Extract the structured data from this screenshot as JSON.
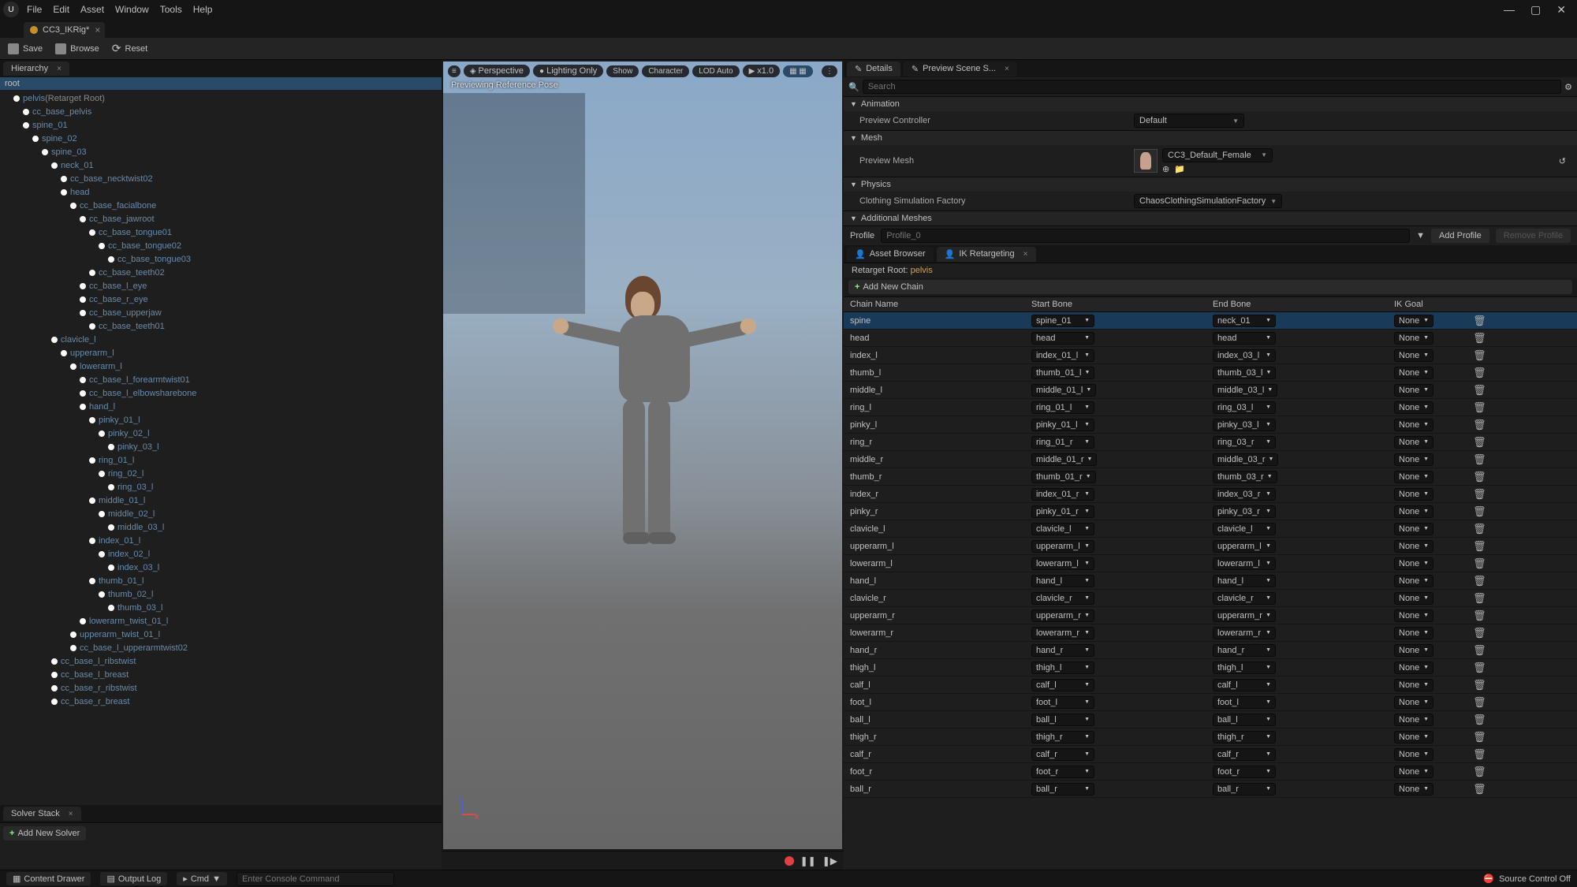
{
  "menu": {
    "file": "File",
    "edit": "Edit",
    "asset": "Asset",
    "window": "Window",
    "tools": "Tools",
    "help": "Help"
  },
  "window_controls": {
    "min": "—",
    "max": "▢",
    "close": "✕"
  },
  "file_tab": {
    "name": "CC3_IKRig*"
  },
  "toolbar": {
    "save": "Save",
    "browse": "Browse",
    "reset": "Reset"
  },
  "panels": {
    "hierarchy": "Hierarchy",
    "solver_stack": "Solver Stack",
    "details": "Details",
    "preview_scene": "Preview Scene S...",
    "asset_browser": "Asset Browser",
    "ik_retargeting": "IK Retargeting"
  },
  "hierarchy": {
    "root_label": "root",
    "retarget_suffix": "(Retarget Root)",
    "bones": [
      {
        "name": "pelvis",
        "indent": 1,
        "retarget": true
      },
      {
        "name": "cc_base_pelvis",
        "indent": 2
      },
      {
        "name": "spine_01",
        "indent": 2
      },
      {
        "name": "spine_02",
        "indent": 3
      },
      {
        "name": "spine_03",
        "indent": 4
      },
      {
        "name": "neck_01",
        "indent": 5
      },
      {
        "name": "cc_base_necktwist02",
        "indent": 6
      },
      {
        "name": "head",
        "indent": 6
      },
      {
        "name": "cc_base_facialbone",
        "indent": 7
      },
      {
        "name": "cc_base_jawroot",
        "indent": 8
      },
      {
        "name": "cc_base_tongue01",
        "indent": 9
      },
      {
        "name": "cc_base_tongue02",
        "indent": 10
      },
      {
        "name": "cc_base_tongue03",
        "indent": 11
      },
      {
        "name": "cc_base_teeth02",
        "indent": 9
      },
      {
        "name": "cc_base_l_eye",
        "indent": 8
      },
      {
        "name": "cc_base_r_eye",
        "indent": 8
      },
      {
        "name": "cc_base_upperjaw",
        "indent": 8
      },
      {
        "name": "cc_base_teeth01",
        "indent": 9
      },
      {
        "name": "clavicle_l",
        "indent": 5
      },
      {
        "name": "upperarm_l",
        "indent": 6
      },
      {
        "name": "lowerarm_l",
        "indent": 7
      },
      {
        "name": "cc_base_l_forearmtwist01",
        "indent": 8
      },
      {
        "name": "cc_base_l_elbowsharebone",
        "indent": 8
      },
      {
        "name": "hand_l",
        "indent": 8
      },
      {
        "name": "pinky_01_l",
        "indent": 9
      },
      {
        "name": "pinky_02_l",
        "indent": 10
      },
      {
        "name": "pinky_03_l",
        "indent": 11
      },
      {
        "name": "ring_01_l",
        "indent": 9
      },
      {
        "name": "ring_02_l",
        "indent": 10
      },
      {
        "name": "ring_03_l",
        "indent": 11
      },
      {
        "name": "middle_01_l",
        "indent": 9
      },
      {
        "name": "middle_02_l",
        "indent": 10
      },
      {
        "name": "middle_03_l",
        "indent": 11
      },
      {
        "name": "index_01_l",
        "indent": 9
      },
      {
        "name": "index_02_l",
        "indent": 10
      },
      {
        "name": "index_03_l",
        "indent": 11
      },
      {
        "name": "thumb_01_l",
        "indent": 9
      },
      {
        "name": "thumb_02_l",
        "indent": 10
      },
      {
        "name": "thumb_03_l",
        "indent": 11
      },
      {
        "name": "lowerarm_twist_01_l",
        "indent": 8
      },
      {
        "name": "upperarm_twist_01_l",
        "indent": 7
      },
      {
        "name": "cc_base_l_upperarmtwist02",
        "indent": 7
      },
      {
        "name": "cc_base_l_ribstwist",
        "indent": 5
      },
      {
        "name": "cc_base_l_breast",
        "indent": 5
      },
      {
        "name": "cc_base_r_ribstwist",
        "indent": 5
      },
      {
        "name": "cc_base_r_breast",
        "indent": 5
      }
    ]
  },
  "solver": {
    "add": "Add New Solver"
  },
  "viewport": {
    "toolbar": {
      "perspective": "Perspective",
      "lighting": "Lighting Only",
      "show": "Show",
      "character": "Character",
      "lod": "LOD Auto",
      "speed": "x1.0"
    },
    "overlay": "Previewing Reference Pose"
  },
  "details": {
    "search_placeholder": "Search",
    "sections": {
      "animation": "Animation",
      "mesh": "Mesh",
      "physics": "Physics",
      "additional": "Additional Meshes"
    },
    "preview_controller_label": "Preview Controller",
    "preview_controller_value": "Default",
    "preview_mesh_label": "Preview Mesh",
    "preview_mesh_value": "CC3_Default_Female",
    "clothing_label": "Clothing Simulation Factory",
    "clothing_value": "ChaosClothingSimulationFactory"
  },
  "profile": {
    "label": "Profile",
    "placeholder": "Profile_0",
    "add": "Add Profile",
    "remove": "Remove Profile"
  },
  "retarget": {
    "root_label": "Retarget Root:",
    "root_value": "pelvis",
    "add_chain": "Add New Chain"
  },
  "chain_headers": {
    "name": "Chain Name",
    "start": "Start Bone",
    "end": "End Bone",
    "goal": "IK Goal"
  },
  "chains": [
    {
      "name": "spine",
      "start": "spine_01",
      "end": "neck_01",
      "goal": "None",
      "selected": true
    },
    {
      "name": "head",
      "start": "head",
      "end": "head",
      "goal": "None"
    },
    {
      "name": "index_l",
      "start": "index_01_l",
      "end": "index_03_l",
      "goal": "None"
    },
    {
      "name": "thumb_l",
      "start": "thumb_01_l",
      "end": "thumb_03_l",
      "goal": "None"
    },
    {
      "name": "middle_l",
      "start": "middle_01_l",
      "end": "middle_03_l",
      "goal": "None"
    },
    {
      "name": "ring_l",
      "start": "ring_01_l",
      "end": "ring_03_l",
      "goal": "None"
    },
    {
      "name": "pinky_l",
      "start": "pinky_01_l",
      "end": "pinky_03_l",
      "goal": "None"
    },
    {
      "name": "ring_r",
      "start": "ring_01_r",
      "end": "ring_03_r",
      "goal": "None"
    },
    {
      "name": "middle_r",
      "start": "middle_01_r",
      "end": "middle_03_r",
      "goal": "None"
    },
    {
      "name": "thumb_r",
      "start": "thumb_01_r",
      "end": "thumb_03_r",
      "goal": "None"
    },
    {
      "name": "index_r",
      "start": "index_01_r",
      "end": "index_03_r",
      "goal": "None"
    },
    {
      "name": "pinky_r",
      "start": "pinky_01_r",
      "end": "pinky_03_r",
      "goal": "None"
    },
    {
      "name": "clavicle_l",
      "start": "clavicle_l",
      "end": "clavicle_l",
      "goal": "None"
    },
    {
      "name": "upperarm_l",
      "start": "upperarm_l",
      "end": "upperarm_l",
      "goal": "None"
    },
    {
      "name": "lowerarm_l",
      "start": "lowerarm_l",
      "end": "lowerarm_l",
      "goal": "None"
    },
    {
      "name": "hand_l",
      "start": "hand_l",
      "end": "hand_l",
      "goal": "None"
    },
    {
      "name": "clavicle_r",
      "start": "clavicle_r",
      "end": "clavicle_r",
      "goal": "None"
    },
    {
      "name": "upperarm_r",
      "start": "upperarm_r",
      "end": "upperarm_r",
      "goal": "None"
    },
    {
      "name": "lowerarm_r",
      "start": "lowerarm_r",
      "end": "lowerarm_r",
      "goal": "None"
    },
    {
      "name": "hand_r",
      "start": "hand_r",
      "end": "hand_r",
      "goal": "None"
    },
    {
      "name": "thigh_l",
      "start": "thigh_l",
      "end": "thigh_l",
      "goal": "None"
    },
    {
      "name": "calf_l",
      "start": "calf_l",
      "end": "calf_l",
      "goal": "None"
    },
    {
      "name": "foot_l",
      "start": "foot_l",
      "end": "foot_l",
      "goal": "None"
    },
    {
      "name": "ball_l",
      "start": "ball_l",
      "end": "ball_l",
      "goal": "None"
    },
    {
      "name": "thigh_r",
      "start": "thigh_r",
      "end": "thigh_r",
      "goal": "None"
    },
    {
      "name": "calf_r",
      "start": "calf_r",
      "end": "calf_r",
      "goal": "None"
    },
    {
      "name": "foot_r",
      "start": "foot_r",
      "end": "foot_r",
      "goal": "None"
    },
    {
      "name": "ball_r",
      "start": "ball_r",
      "end": "ball_r",
      "goal": "None"
    }
  ],
  "statusbar": {
    "content_drawer": "Content Drawer",
    "output_log": "Output Log",
    "cmd": "Cmd",
    "cmd_placeholder": "Enter Console Command",
    "source_control": "Source Control Off"
  }
}
